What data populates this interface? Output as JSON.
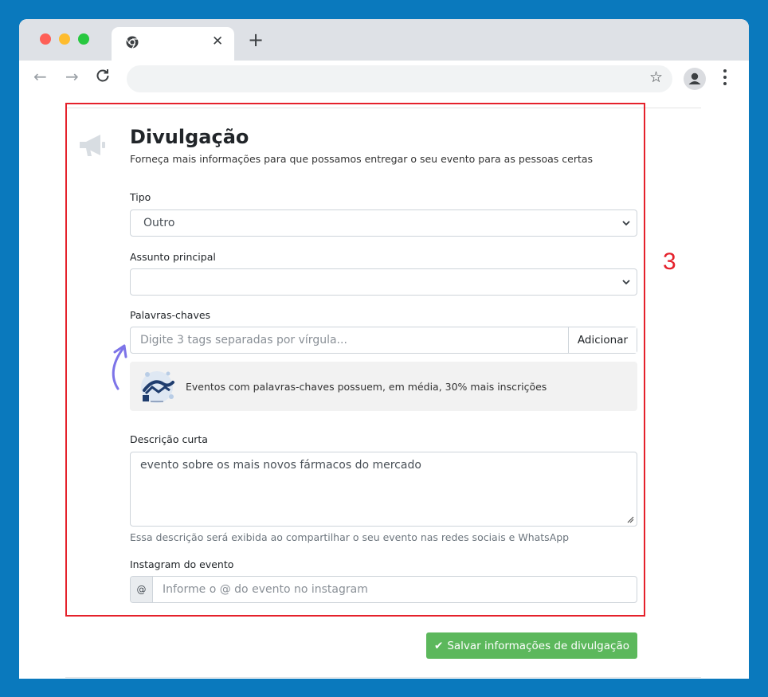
{
  "browser": {
    "tab_close": "✕",
    "new_tab": "+",
    "nav_back": "←",
    "nav_forward": "→",
    "nav_reload": "C",
    "star": "☆"
  },
  "annotation": {
    "step_number": "3",
    "highlight_color": "#e5212b"
  },
  "section": {
    "icon": "megaphone-icon",
    "title": "Divulgação",
    "subtitle": "Forneça mais informações para que possamos entregar o seu evento para as pessoas certas"
  },
  "form": {
    "tipo": {
      "label": "Tipo",
      "value": "Outro"
    },
    "assunto": {
      "label": "Assunto principal",
      "value": ""
    },
    "palavras": {
      "label": "Palavras-chaves",
      "placeholder": "Digite 3 tags separadas por vírgula...",
      "add_label": "Adicionar"
    },
    "tip": {
      "text": "Eventos com palavras-chaves possuem, em média, 30% mais inscrições"
    },
    "descricao": {
      "label": "Descrição curta",
      "value": "evento sobre os mais novos fármacos do mercado",
      "help": "Essa descrição será exibida ao compartilhar o seu evento nas redes sociais e WhatsApp"
    },
    "instagram": {
      "label": "Instagram do evento",
      "addon": "@",
      "placeholder": "Informe o @ do evento no instagram"
    }
  },
  "actions": {
    "save_label": "Salvar informações de divulgação",
    "save_color": "#5cb85c"
  }
}
